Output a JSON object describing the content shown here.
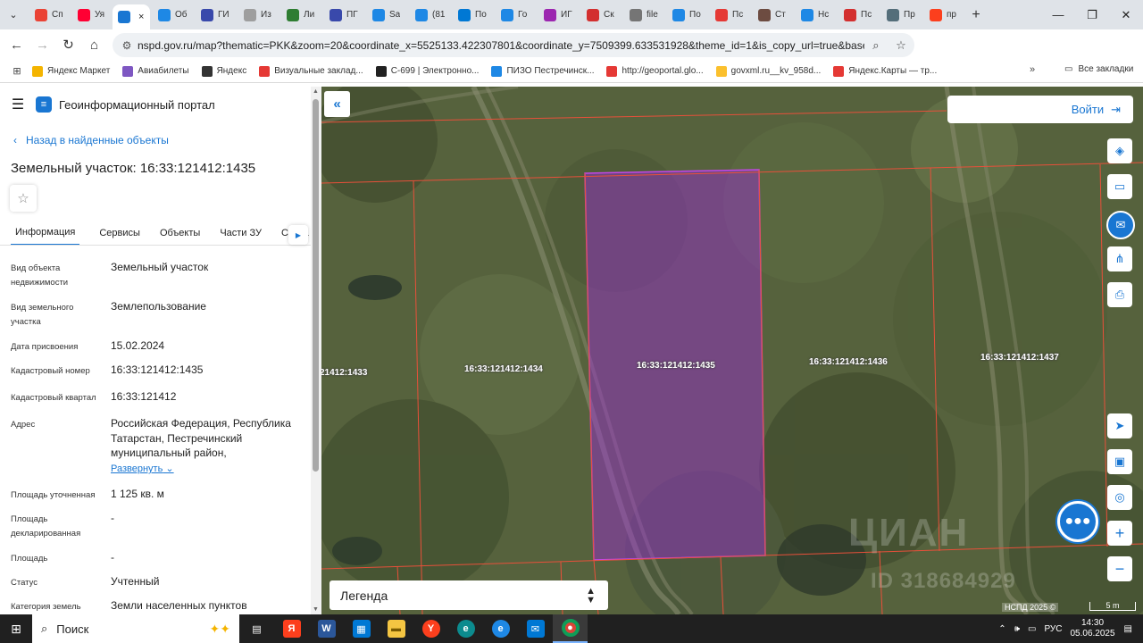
{
  "browser": {
    "tabs": [
      {
        "label": "Сп",
        "icon": "gmail-icon",
        "color": "#ea4335"
      },
      {
        "label": "Уя",
        "icon": "youtube-icon",
        "color": "#ff0033"
      },
      {
        "label": "×",
        "icon": "nspd-icon",
        "color": "#1976d2",
        "active": true
      },
      {
        "label": "Об",
        "icon": "document-icon",
        "color": "#1e88e5"
      },
      {
        "label": "ГИ",
        "icon": "emblem-icon",
        "color": "#3949ab"
      },
      {
        "label": "Из",
        "icon": "doc-icon",
        "color": "#9e9e9e"
      },
      {
        "label": "Ли",
        "icon": "map-icon",
        "color": "#2e7d32"
      },
      {
        "label": "ПГ",
        "icon": "emblem-icon",
        "color": "#3949ab"
      },
      {
        "label": "Sa",
        "icon": "globe-icon",
        "color": "#1e88e5"
      },
      {
        "label": "(81",
        "icon": "mail-icon",
        "color": "#1e88e5"
      },
      {
        "label": "По",
        "icon": "outlook-icon",
        "color": "#0078d4"
      },
      {
        "label": "Го",
        "icon": "document-icon",
        "color": "#1e88e5"
      },
      {
        "label": "ИГ",
        "icon": "podcast-icon",
        "color": "#9c27b0"
      },
      {
        "label": "Ск",
        "icon": "heart-icon",
        "color": "#d32f2f"
      },
      {
        "label": "file",
        "icon": "globe-icon",
        "color": "#757575"
      },
      {
        "label": "По",
        "icon": "document-icon",
        "color": "#1e88e5"
      },
      {
        "label": "Пс",
        "icon": "avito-icon",
        "color": "#e53935"
      },
      {
        "label": "Ст",
        "icon": "avatar-icon",
        "color": "#6d4c41"
      },
      {
        "label": "Нс",
        "icon": "triangle-icon",
        "color": "#1e88e5"
      },
      {
        "label": "Пс",
        "icon": "flag-icon",
        "color": "#d32f2f"
      },
      {
        "label": "Пр",
        "icon": "clock-icon",
        "color": "#546e7a"
      },
      {
        "label": "пр",
        "icon": "yandex-icon",
        "color": "#fc3f1d"
      }
    ],
    "url": "nspd.gov.ru/map?thematic=PKK&zoom=20&coordinate_x=5525133.422307801&coordinate_y=7509399.633531928&theme_id=1&is_copy_url=true&baseLayerId...",
    "bookmarks": [
      {
        "label": "Яндекс Маркет",
        "color": "#f4b400"
      },
      {
        "label": "Авиабилеты",
        "color": "#7e57c2"
      },
      {
        "label": "Яндекс",
        "color": "#333333"
      },
      {
        "label": "Визуальные заклад...",
        "color": "#e53935"
      },
      {
        "label": "С-699 | Электронно...",
        "color": "#212121"
      },
      {
        "label": "ПИЗО Пестречинск...",
        "color": "#1e88e5"
      },
      {
        "label": "http://geoportal.glo...",
        "color": "#e53935"
      },
      {
        "label": "govxml.ru__kv_958d...",
        "color": "#fbc02d"
      },
      {
        "label": "Яндекс.Карты — тр...",
        "color": "#e53935"
      }
    ],
    "all_bookmarks": "Все закладки"
  },
  "panel": {
    "portal_title": "Геоинформационный портал",
    "back_link": "Назад в найденные объекты",
    "object_title": "Земельный участок: 16:33:121412:1435",
    "tabs": [
      "Информация",
      "Сервисы",
      "Объекты",
      "Части ЗУ",
      "Соста"
    ],
    "properties": [
      {
        "key": "Вид объекта недвижимости",
        "value": "Земельный участок"
      },
      {
        "key": "Вид земельного участка",
        "value": "Землепользование"
      },
      {
        "key": "Дата присвоения",
        "value": "15.02.2024"
      },
      {
        "key": "Кадастровый номер",
        "value": "16:33:121412:1435"
      },
      {
        "key": "Кадастровый квартал",
        "value": "16:33:121412"
      },
      {
        "key": "Адрес",
        "value": "Российская Федерация, Республика Татарстан, Пестречинский муниципальный район,"
      },
      {
        "key": "Площадь уточненная",
        "value": "1 125 кв. м"
      },
      {
        "key": "Площадь декларированная",
        "value": "-"
      },
      {
        "key": "Площадь",
        "value": "-"
      },
      {
        "key": "Статус",
        "value": "Учтенный"
      },
      {
        "key": "Категория земель",
        "value": "Земли населенных пунктов"
      }
    ],
    "expand_label": "Развернуть"
  },
  "map": {
    "login_label": "Войти",
    "legend_label": "Легенда",
    "attribution": "НСПД 2025 ©",
    "scale": "5 m",
    "watermark": "ЦИАН",
    "watermark_id": "ID 318684929",
    "parcels": [
      "21412:1433",
      "16:33:121412:1434",
      "16:33:121412:1435",
      "16:33:121412:1436",
      "16:33:121412:1437"
    ],
    "selected_parcel_color": "#9b2bd6",
    "boundary_color": "#e8503a"
  },
  "taskbar": {
    "search_label": "Поиск",
    "language": "РУС",
    "time": "14:30",
    "date": "05.06.2025"
  }
}
